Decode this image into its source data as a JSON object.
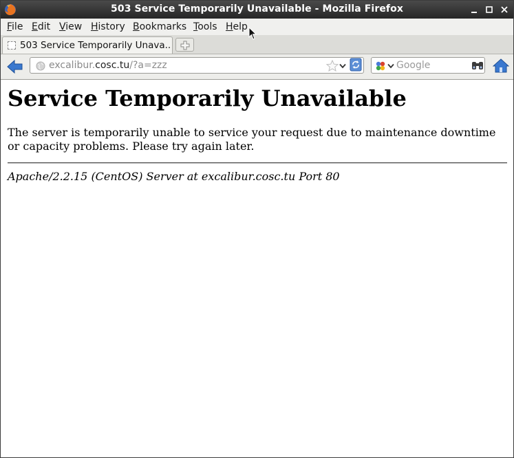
{
  "window": {
    "title": "503 Service Temporarily Unavailable - Mozilla Firefox",
    "controls": {
      "minimize": "minimize-icon",
      "maximize": "maximize-icon",
      "close": "close-icon"
    }
  },
  "menubar": {
    "items": [
      {
        "mnemonic": "F",
        "rest": "ile"
      },
      {
        "mnemonic": "E",
        "rest": "dit"
      },
      {
        "mnemonic": "V",
        "rest": "iew"
      },
      {
        "mnemonic": "H",
        "rest": "istory"
      },
      {
        "mnemonic": "B",
        "rest": "ookmarks"
      },
      {
        "mnemonic": "T",
        "rest": "ools"
      },
      {
        "mnemonic": "H",
        "rest": "elp"
      }
    ]
  },
  "tabs": {
    "active_label": "503 Service Temporarily Unava..."
  },
  "navbar": {
    "url_domain": "excalibur.cosc.tu",
    "url_prefix": "excalibur.",
    "url_host": "cosc.tu",
    "url_path": "/?a=zzz",
    "search_placeholder": "Google"
  },
  "page": {
    "heading": "Service Temporarily Unavailable",
    "message": "The server is temporarily unable to service your request due to maintenance downtime or capacity problems. Please try again later.",
    "address": "Apache/2.2.15 (CentOS) Server at excalibur.cosc.tu Port 80"
  },
  "colors": {
    "titlebar": "#2e2e2e",
    "chrome": "#ededea",
    "nav_icon_blue": "#2f6fc3"
  }
}
